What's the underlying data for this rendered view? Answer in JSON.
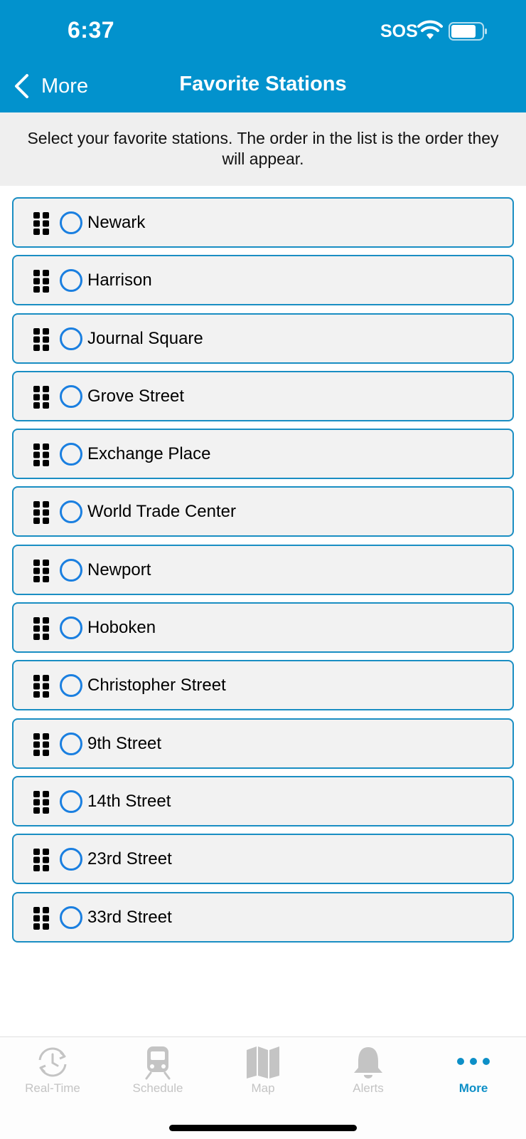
{
  "status_bar": {
    "time": "6:37",
    "sos": "SOS"
  },
  "nav": {
    "back_label": "More",
    "title": "Favorite Stations"
  },
  "instructions": "Select your favorite stations. The order in the list is the order they will appear.",
  "stations": [
    {
      "name": "Newark",
      "selected": false
    },
    {
      "name": "Harrison",
      "selected": false
    },
    {
      "name": "Journal Square",
      "selected": false
    },
    {
      "name": "Grove Street",
      "selected": false
    },
    {
      "name": "Exchange Place",
      "selected": false
    },
    {
      "name": "World Trade Center",
      "selected": false
    },
    {
      "name": "Newport",
      "selected": false
    },
    {
      "name": "Hoboken",
      "selected": false
    },
    {
      "name": "Christopher Street",
      "selected": false
    },
    {
      "name": "9th Street",
      "selected": false
    },
    {
      "name": "14th Street",
      "selected": false
    },
    {
      "name": "23rd Street",
      "selected": false
    },
    {
      "name": "33rd Street",
      "selected": false
    }
  ],
  "tabs": [
    {
      "label": "Real-Time",
      "icon": "clock-arrows-icon",
      "active": false
    },
    {
      "label": "Schedule",
      "icon": "train-icon",
      "active": false
    },
    {
      "label": "Map",
      "icon": "map-icon",
      "active": false
    },
    {
      "label": "Alerts",
      "icon": "bell-icon",
      "active": false
    },
    {
      "label": "More",
      "icon": "more-dots-icon",
      "active": true
    }
  ],
  "colors": {
    "header": "#0292cd",
    "row_border": "#1a8ec3",
    "radio": "#1a7fe0",
    "tab_active": "#0d8fc7",
    "tab_inactive": "#c4c4c4"
  }
}
